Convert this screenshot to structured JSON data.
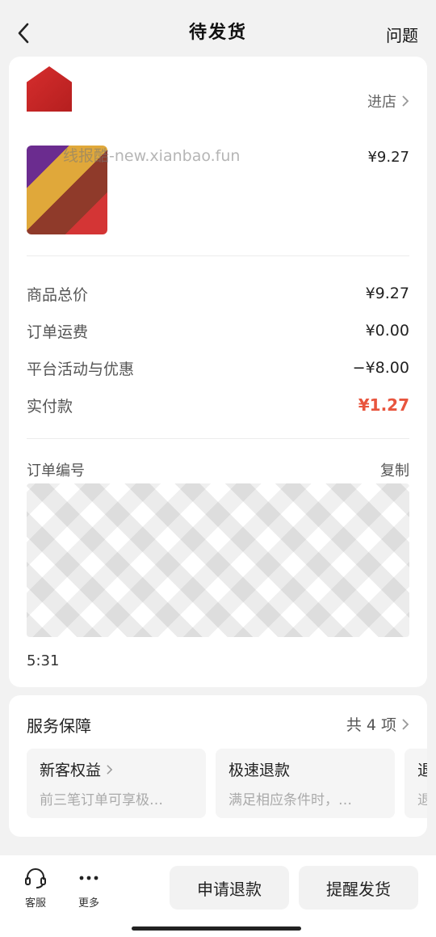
{
  "header": {
    "title": "待发货",
    "right_label": "问题"
  },
  "shop": {
    "link_label": "进店"
  },
  "product": {
    "price": "¥9.27"
  },
  "watermark": "线报酷-new.xianbao.fun",
  "prices": [
    {
      "label": "商品总价",
      "value": "¥9.27"
    },
    {
      "label": "订单运费",
      "value": "¥0.00"
    },
    {
      "label": "平台活动与优惠",
      "value": "−¥8.00"
    },
    {
      "label": "实付款",
      "value": "¥1.27"
    }
  ],
  "order_info": {
    "number_label": "订单编号",
    "copy_label": "复制",
    "time_fragment": "5:31"
  },
  "service": {
    "title": "服务保障",
    "count": "共 4 项",
    "items": [
      {
        "title": "新客权益",
        "desc": "前三笔订单可享极…"
      },
      {
        "title": "极速退款",
        "desc": "满足相应条件时，…"
      },
      {
        "title": "退",
        "desc": "退"
      }
    ]
  },
  "bottom_bar": {
    "service_label": "客服",
    "more_label": "更多",
    "refund_label": "申请退款",
    "remind_label": "提醒发货"
  },
  "colors": {
    "accent": "#e8553e",
    "background": "#f2f2f2"
  }
}
